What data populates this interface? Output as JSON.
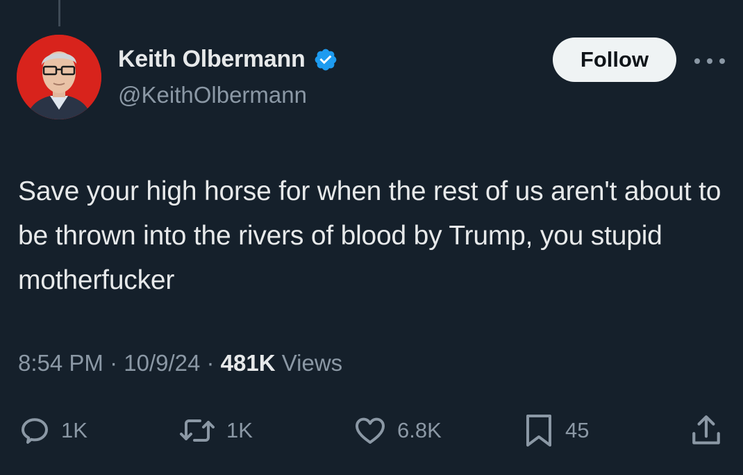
{
  "author": {
    "display_name": "Keith Olbermann",
    "handle": "@KeithOlbermann",
    "verified": true
  },
  "follow_label": "Follow",
  "tweet_text": "Save your high horse for when the rest of us aren't about to be thrown into the rivers of blood by Trump, you stupid motherfucker",
  "meta": {
    "time": "8:54 PM",
    "separator": " · ",
    "date": "10/9/24",
    "views_count": "481K",
    "views_label": " Views"
  },
  "actions": {
    "replies": "1K",
    "reposts": "1K",
    "likes": "6.8K",
    "bookmarks": "45"
  },
  "icons": {
    "reply": "reply-icon",
    "repost": "repost-icon",
    "like": "heart-icon",
    "bookmark": "bookmark-icon",
    "share": "share-icon",
    "more": "more-icon",
    "verified": "verified-badge-icon"
  },
  "colors": {
    "background": "#15202b",
    "text": "#e7e9ea",
    "secondary": "#8b98a5",
    "verified": "#1d9bf0",
    "avatar_bg": "#d8231c"
  }
}
